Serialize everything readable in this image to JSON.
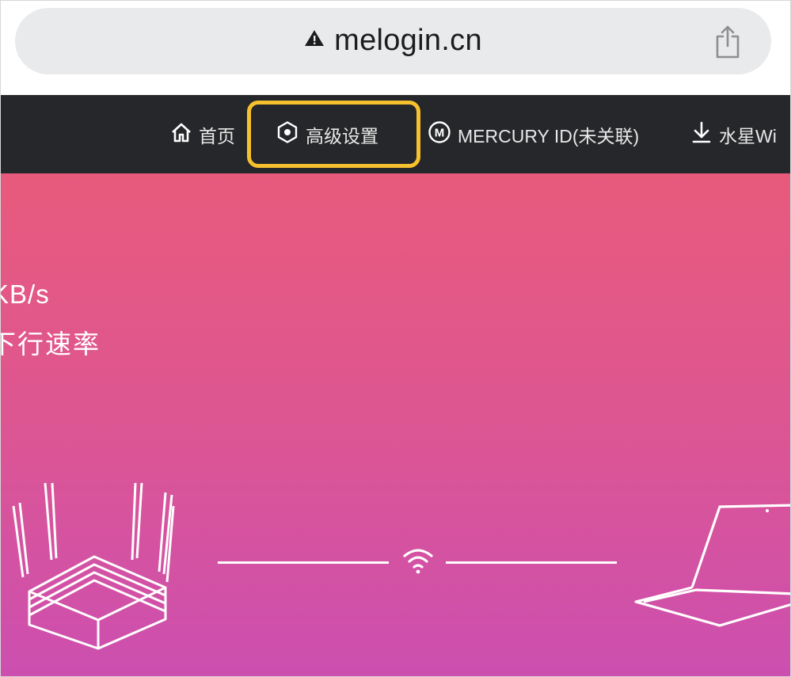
{
  "browser": {
    "url": "melogin.cn",
    "lock_icon": "warning-triangle-icon",
    "share_icon": "share-icon"
  },
  "nav": {
    "home": {
      "label": "首页",
      "icon": "home-icon"
    },
    "advanced": {
      "label": "高级设置",
      "icon": "gear-icon",
      "highlight_color": "#f6c12e"
    },
    "mercury_id": {
      "label": "MERCURY ID(未关联)",
      "icon": "mercury-m-icon"
    },
    "download": {
      "label": "水星Wi",
      "icon": "download-icon"
    }
  },
  "hero": {
    "speed_value": "KB/s",
    "speed_label": "下行速率",
    "gradient_top": "#e85a7c",
    "gradient_bottom": "#cc4fb0",
    "router_icon": "router-icon",
    "wifi_icon": "wifi-icon",
    "laptop_icon": "laptop-icon"
  }
}
